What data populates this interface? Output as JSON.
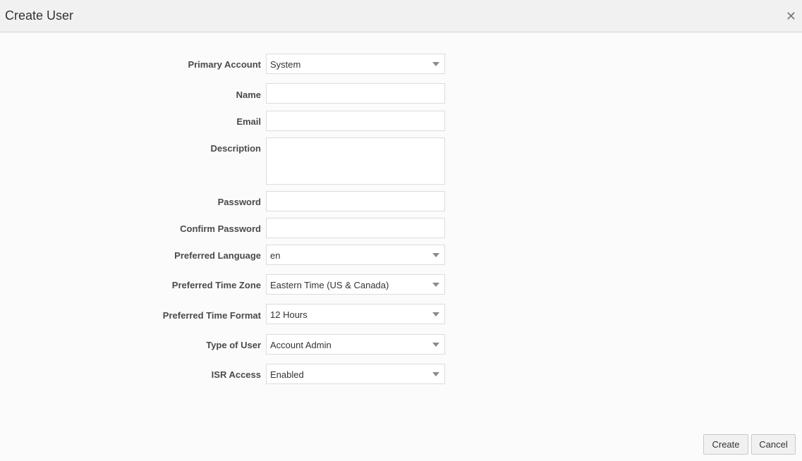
{
  "dialog": {
    "title": "Create User"
  },
  "form": {
    "primary_account": {
      "label": "Primary Account",
      "value": "System"
    },
    "name": {
      "label": "Name",
      "value": ""
    },
    "email": {
      "label": "Email",
      "value": ""
    },
    "description": {
      "label": "Description",
      "value": ""
    },
    "password": {
      "label": "Password",
      "value": ""
    },
    "confirm_password": {
      "label": "Confirm Password",
      "value": ""
    },
    "preferred_language": {
      "label": "Preferred Language",
      "value": "en"
    },
    "preferred_time_zone": {
      "label": "Preferred Time Zone",
      "value": "Eastern Time (US & Canada)"
    },
    "preferred_time_format": {
      "label": "Preferred Time Format",
      "value": "12 Hours"
    },
    "type_of_user": {
      "label": "Type of User",
      "value": "Account Admin"
    },
    "isr_access": {
      "label": "ISR Access",
      "value": "Enabled"
    }
  },
  "footer": {
    "create_label": "Create",
    "cancel_label": "Cancel"
  },
  "icons": {
    "close": "close-icon",
    "dropdown": "chevron-down-icon"
  }
}
